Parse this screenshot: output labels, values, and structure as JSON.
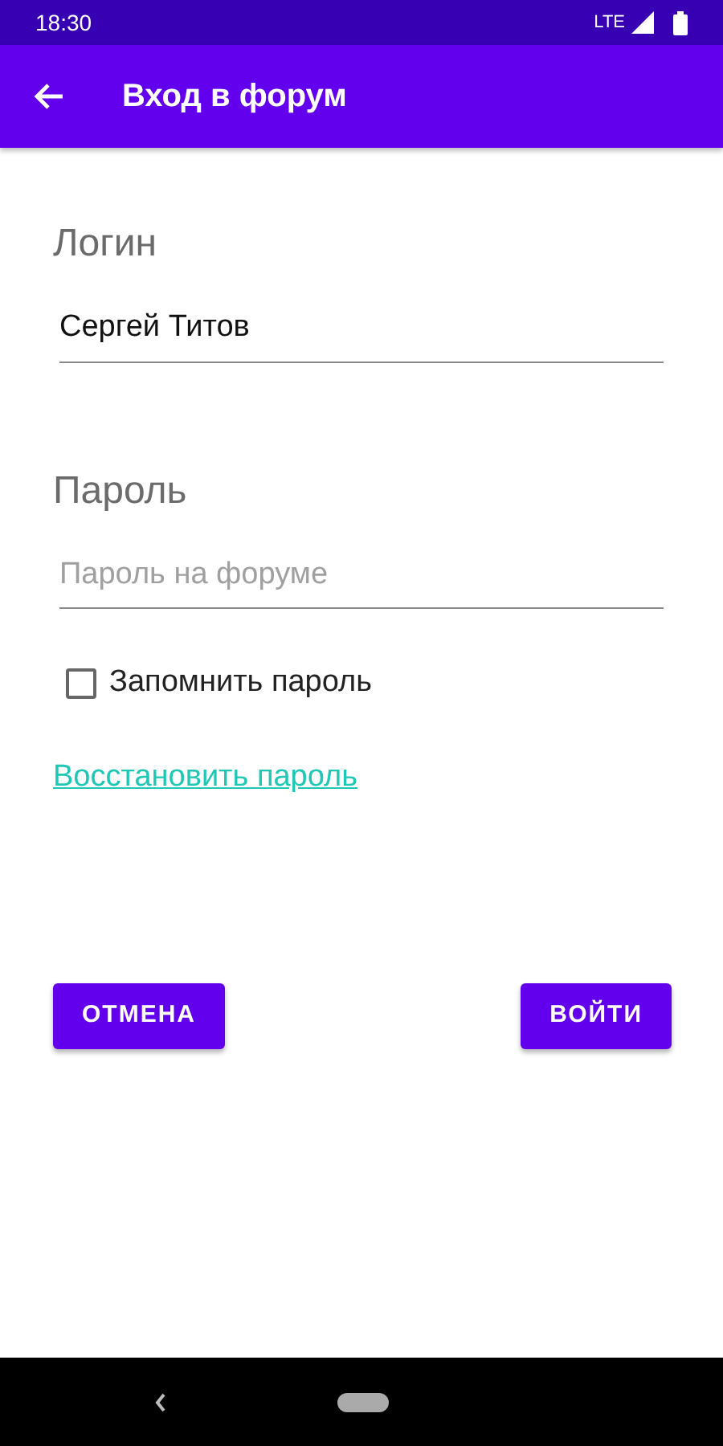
{
  "status_bar": {
    "time": "18:30",
    "network": "LTE"
  },
  "app_bar": {
    "title": "Вход в форум"
  },
  "form": {
    "login": {
      "label": "Логин",
      "value": "Сергей Титов"
    },
    "password": {
      "label": "Пароль",
      "placeholder": "Пароль на форуме"
    },
    "remember": {
      "label": "Запомнить пароль",
      "checked": false
    },
    "restore_link": "Восстановить пароль"
  },
  "buttons": [
    {
      "label": "ОТМЕНА"
    },
    {
      "label": "ВОЙТИ"
    }
  ]
}
